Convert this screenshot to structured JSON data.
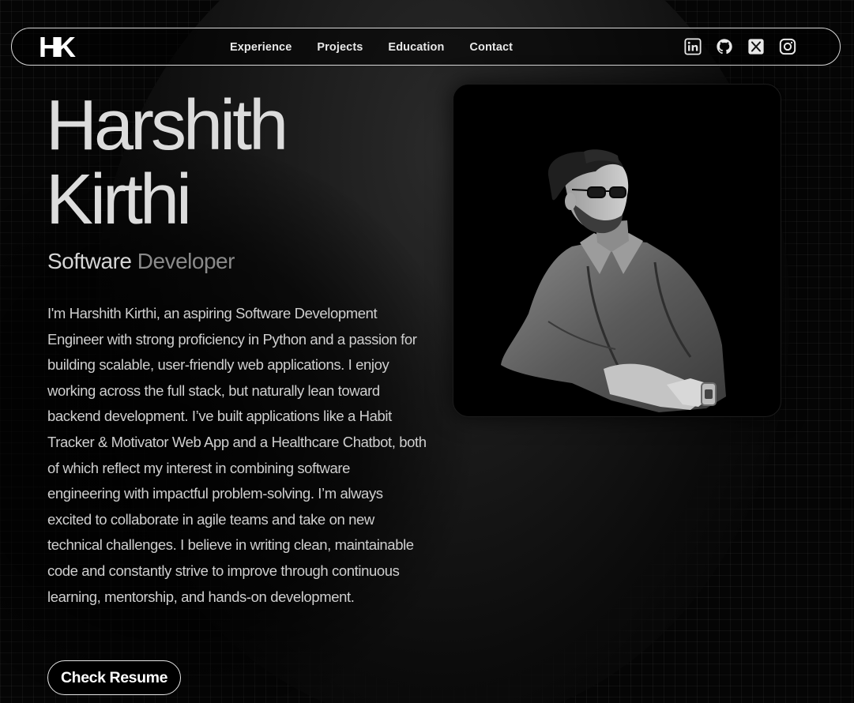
{
  "nav": {
    "logo": "HK",
    "links": [
      "Experience",
      "Projects",
      "Education",
      "Contact"
    ],
    "socials": [
      "linkedin-icon",
      "github-icon",
      "x-icon",
      "instagram-icon"
    ]
  },
  "hero": {
    "name_line1": "Harshith",
    "name_line2": "Kirthi",
    "role_part1": "Software ",
    "role_part2": "Developer",
    "bio": "I'm Harshith Kirthi, an aspiring Software Development Engineer with strong proficiency in Python and a passion for building scalable, user-friendly web applications. I enjoy working across the full stack, but naturally lean toward backend development. I’ve built applications like a Habit Tracker & Motivator Web App and a Healthcare Chatbot, both of which reflect my interest in combining software engineering with impactful problem-solving. I’m always excited to collaborate in agile teams and take on new technical challenges. I believe in writing clean, maintainable code and constantly strive to improve through continuous learning, mentorship, and hands-on development.",
    "resume_label": "Check Resume"
  },
  "colors": {
    "background": "#050505",
    "name": "#dcdcdc",
    "role_dim": "#8a8a8a",
    "text": "#cfcfcf",
    "border": "#d8d8d8"
  }
}
